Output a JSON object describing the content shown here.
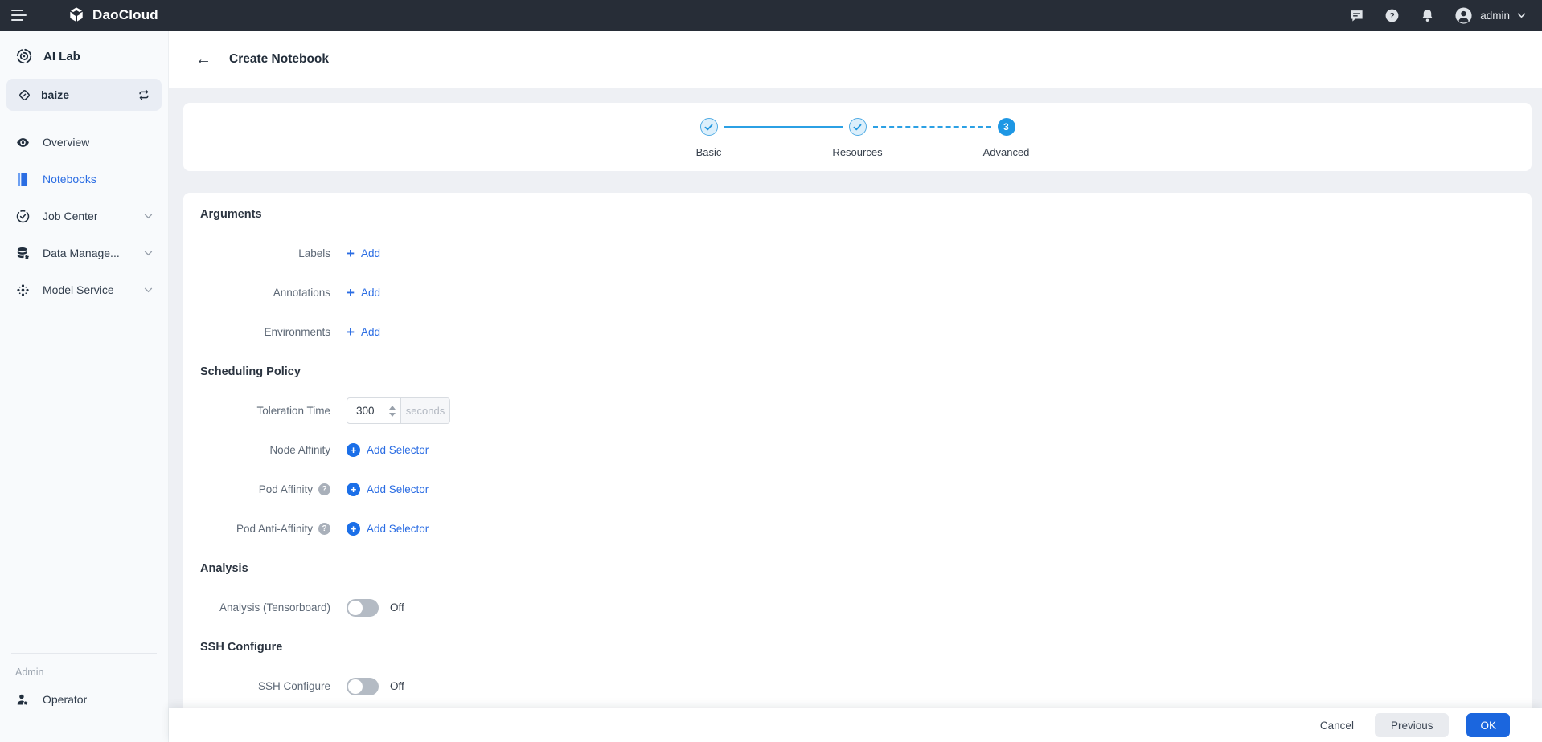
{
  "colors": {
    "topbar_bg": "#272d37",
    "accent_blue": "#2b6de3",
    "stepper_blue": "#2ba0e4",
    "step_current_bg": "#1e97e4",
    "ok_button_bg": "#1b66de",
    "content_bg": "#eef0f4",
    "toggle_off": "#b4bbc4"
  },
  "icons": {
    "back": "←",
    "plus": "+",
    "help": "?"
  },
  "topbar": {
    "brand": "DaoCloud",
    "username": "admin"
  },
  "sidebar": {
    "product_title": "AI Lab",
    "workspace": {
      "name": "baize"
    },
    "items": [
      {
        "label": "Overview",
        "active": false,
        "expandable": false
      },
      {
        "label": "Notebooks",
        "active": true,
        "expandable": false
      },
      {
        "label": "Job Center",
        "active": false,
        "expandable": true
      },
      {
        "label": "Data Manage...",
        "active": false,
        "expandable": true
      },
      {
        "label": "Model Service",
        "active": false,
        "expandable": true
      }
    ],
    "section_label": "Admin",
    "admin_item": "Operator"
  },
  "page": {
    "title": "Create Notebook"
  },
  "stepper": {
    "steps": [
      {
        "label": "Basic",
        "state": "complete"
      },
      {
        "label": "Resources",
        "state": "complete"
      },
      {
        "label": "Advanced",
        "state": "current",
        "number": "3"
      }
    ]
  },
  "form": {
    "arguments": {
      "title": "Arguments",
      "labels": {
        "label": "Labels",
        "action": "Add"
      },
      "annotations": {
        "label": "Annotations",
        "action": "Add"
      },
      "environments": {
        "label": "Environments",
        "action": "Add"
      }
    },
    "scheduling": {
      "title": "Scheduling Policy",
      "toleration": {
        "label": "Toleration Time",
        "value": "300",
        "unit": "seconds"
      },
      "node_affinity": {
        "label": "Node Affinity",
        "action": "Add Selector"
      },
      "pod_affinity": {
        "label": "Pod Affinity",
        "action": "Add Selector"
      },
      "pod_anti_affinity": {
        "label": "Pod Anti-Affinity",
        "action": "Add Selector"
      }
    },
    "analysis": {
      "title": "Analysis",
      "tensorboard": {
        "label": "Analysis (Tensorboard)",
        "state": "Off"
      }
    },
    "ssh": {
      "title": "SSH Configure",
      "ssh_configure": {
        "label": "SSH Configure",
        "state": "Off"
      }
    }
  },
  "footer": {
    "cancel": "Cancel",
    "previous": "Previous",
    "ok": "OK"
  }
}
